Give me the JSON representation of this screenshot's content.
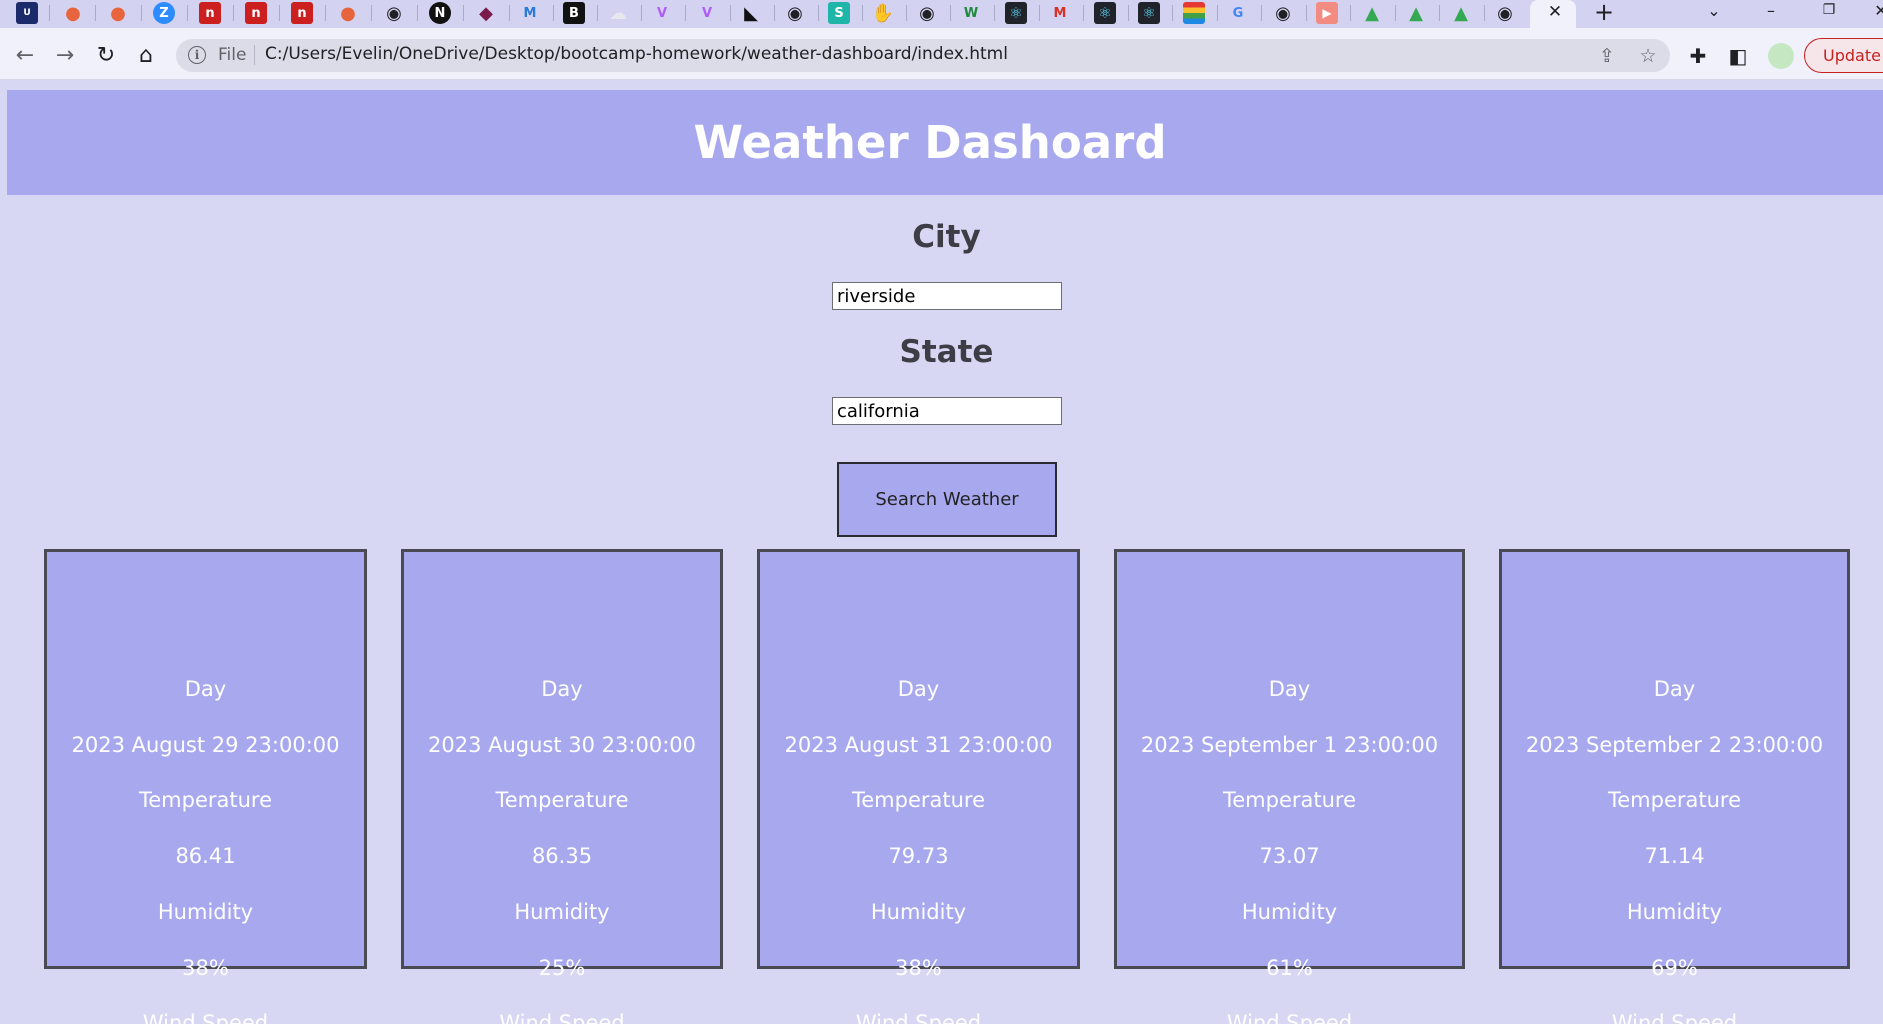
{
  "browser": {
    "address_scheme": "File",
    "url": "C:/Users/Evelin/OneDrive/Desktop/bootcamp-homework/weather-dashboard/index.html",
    "update_label": "Update",
    "tab_close_glyph": "✕",
    "new_tab_glyph": "+"
  },
  "page": {
    "title": "Weather Dashoard",
    "city_label": "City",
    "city_value": "riverside",
    "state_label": "State",
    "state_value": "california",
    "search_button": "Search Weather"
  },
  "forecast": [
    {
      "day_label": "Day",
      "date": "2023 August 29 23:00:00",
      "temp_label": "Temperature",
      "temp": "86.41",
      "humidity_label": "Humidity",
      "humidity": "38%",
      "wind_label": "Wind Speed"
    },
    {
      "day_label": "Day",
      "date": "2023 August 30 23:00:00",
      "temp_label": "Temperature",
      "temp": "86.35",
      "humidity_label": "Humidity",
      "humidity": "25%",
      "wind_label": "Wind Speed"
    },
    {
      "day_label": "Day",
      "date": "2023 August 31 23:00:00",
      "temp_label": "Temperature",
      "temp": "79.73",
      "humidity_label": "Humidity",
      "humidity": "38%",
      "wind_label": "Wind Speed"
    },
    {
      "day_label": "Day",
      "date": "2023 September 1 23:00:00",
      "temp_label": "Temperature",
      "temp": "73.07",
      "humidity_label": "Humidity",
      "humidity": "61%",
      "wind_label": "Wind Speed"
    },
    {
      "day_label": "Day",
      "date": "2023 September 2 23:00:00",
      "temp_label": "Temperature",
      "temp": "71.14",
      "humidity_label": "Humidity",
      "humidity": "69%",
      "wind_label": "Wind Speed"
    }
  ]
}
